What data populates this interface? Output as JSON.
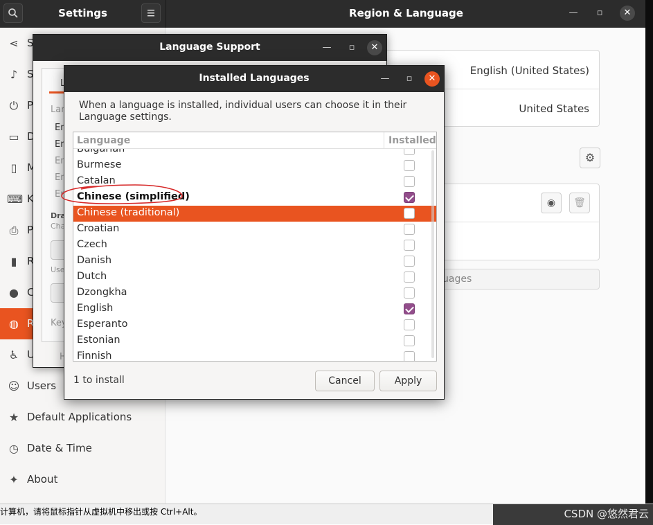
{
  "settings": {
    "left_title": "Settings",
    "right_title": "Region & Language",
    "search_icon": "search-icon",
    "menu_icon": "hamburger-menu-icon",
    "sidebar": [
      {
        "label": "S",
        "icon": "share-icon"
      },
      {
        "label": "S",
        "icon": "music-note-icon"
      },
      {
        "label": "P",
        "icon": "power-icon"
      },
      {
        "label": "D",
        "icon": "display-icon"
      },
      {
        "label": "M",
        "icon": "mouse-icon"
      },
      {
        "label": "K",
        "icon": "keyboard-icon"
      },
      {
        "label": "P",
        "icon": "printer-icon"
      },
      {
        "label": "R",
        "icon": "removable-media-icon"
      },
      {
        "label": "C",
        "icon": "color-icon"
      },
      {
        "label": "R",
        "icon": "region-globe-icon",
        "active": true
      },
      {
        "label": "U",
        "icon": "accessibility-icon"
      },
      {
        "label": "Users",
        "icon": "user-icon"
      },
      {
        "label": "Default Applications",
        "icon": "star-icon"
      },
      {
        "label": "Date & Time",
        "icon": "clock-icon"
      },
      {
        "label": "About",
        "icon": "about-icon"
      }
    ],
    "content": {
      "language_value": "English (United States)",
      "formats_value": "United States",
      "manage_languages_partial": "uages"
    }
  },
  "language_support": {
    "title": "Language Support",
    "tab_partial": "L",
    "lang_label_partial": "Lan",
    "rows_partial": [
      "En",
      "En",
      "En",
      "En",
      "En"
    ],
    "drag_partial": "Dra",
    "change_partial": "Cha",
    "use_partial": "Use",
    "key_partial": "Key",
    "help_partial": "H"
  },
  "installed_languages": {
    "title": "Installed Languages",
    "description": "When a language is installed, individual users can choose it in their Language settings.",
    "col_language": "Language",
    "col_installed": "Installed",
    "rows": [
      {
        "name": "Bulgarian",
        "installed": false,
        "partial": true
      },
      {
        "name": "Burmese",
        "installed": false
      },
      {
        "name": "Catalan",
        "installed": false
      },
      {
        "name": "Chinese (simplified)",
        "installed": true,
        "bold": true
      },
      {
        "name": "Chinese (traditional)",
        "installed": false,
        "selected": true
      },
      {
        "name": "Croatian",
        "installed": false
      },
      {
        "name": "Czech",
        "installed": false
      },
      {
        "name": "Danish",
        "installed": false
      },
      {
        "name": "Dutch",
        "installed": false
      },
      {
        "name": "Dzongkha",
        "installed": false
      },
      {
        "name": "English",
        "installed": true
      },
      {
        "name": "Esperanto",
        "installed": false
      },
      {
        "name": "Estonian",
        "installed": false
      },
      {
        "name": "Finnish",
        "installed": false
      }
    ],
    "status": "1 to install",
    "cancel_label": "Cancel",
    "apply_label": "Apply"
  },
  "taskbar": {
    "message": "计算机，请将鼠标指针从虚拟机中移出或按 Ctrl+Alt。",
    "watermark": "CSDN @悠然君云"
  },
  "colors": {
    "accent": "#e95420",
    "checkbox_checked": "#924d8b",
    "headerbar": "#2c2c2c",
    "annotation": "#d62828"
  }
}
